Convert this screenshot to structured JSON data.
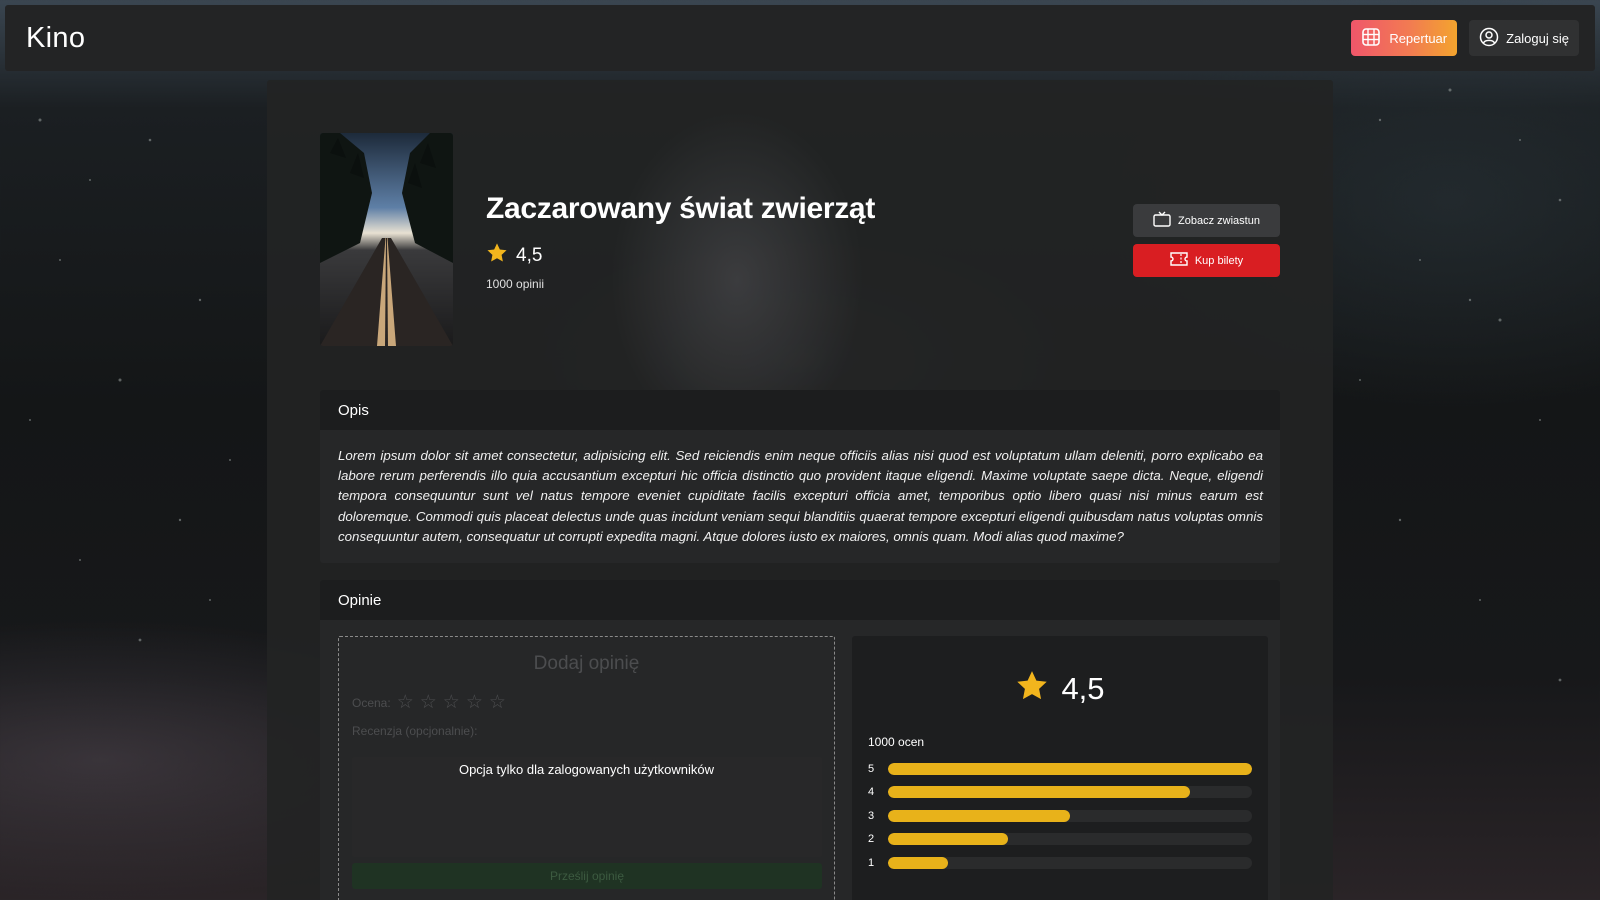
{
  "navbar": {
    "brand": "Kino",
    "repertuar_label": "Repertuar",
    "login_label": "Zaloguj się"
  },
  "movie": {
    "title": "Zaczarowany świat zwierząt",
    "rating": "4,5",
    "reviews_count": "1000 opinii",
    "trailer_label": "Zobacz zwiastun",
    "tickets_label": "Kup bilety"
  },
  "description": {
    "header": "Opis",
    "text": "Lorem ipsum dolor sit amet consectetur, adipisicing elit. Sed reiciendis enim neque officiis alias nisi quod est voluptatum ullam deleniti, porro explicabo ea labore rerum perferendis illo quia accusantium excepturi hic officia distinctio quo provident itaque eligendi. Maxime voluptate saepe dicta. Neque, eligendi tempora consequuntur sunt vel natus tempore eveniet cupiditate facilis excepturi officia amet, temporibus optio libero quasi nisi minus earum est doloremque. Commodi quis placeat delectus unde quas incidunt veniam sequi blanditiis quaerat tempore excepturi eligendi quibusdam natus voluptas omnis consequuntur autem, consequatur ut corrupti expedita magni. Atque dolores iusto ex maiores, omnis quam. Modi alias quod maxime?"
  },
  "reviews": {
    "header": "Opinie",
    "add_title": "Dodaj opinię",
    "score_label": "Ocena:",
    "review_label": "Recenzja (opcjonalnie):",
    "login_only": "Opcja tylko dla zalogowanych użytkowników",
    "submit_label": "Prześlij opinię",
    "summary_rating": "4,5",
    "summary_count": "1000 ocen",
    "distribution": [
      {
        "label": "5",
        "fraction": 1.0
      },
      {
        "label": "4",
        "fraction": 0.83
      },
      {
        "label": "3",
        "fraction": 0.5
      },
      {
        "label": "2",
        "fraction": 0.33
      },
      {
        "label": "1",
        "fraction": 0.165
      }
    ]
  },
  "colors": {
    "star": "#f2b51d",
    "bar": "#e8b21a",
    "tickets": "#d91e22"
  }
}
